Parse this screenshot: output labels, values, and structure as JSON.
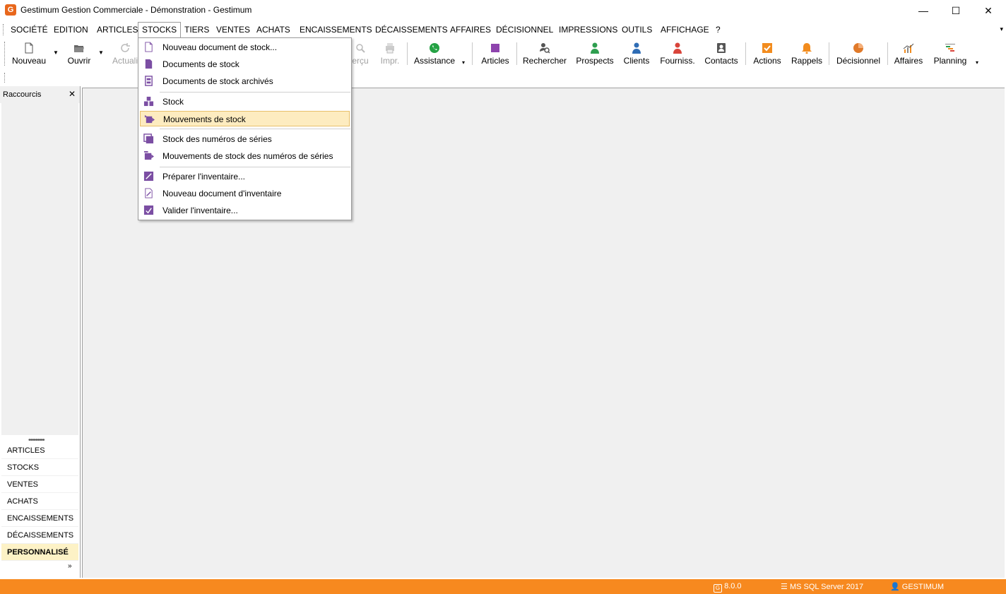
{
  "window": {
    "title": "Gestimum Gestion Commerciale - Démonstration - Gestimum",
    "app_icon": "G",
    "minimize_glyph": "—",
    "maximize_glyph": "☐",
    "close_glyph": "✕"
  },
  "menubar": {
    "items": [
      "SOCIÉTÉ",
      "EDITION",
      "ARTICLES",
      "STOCKS",
      "TIERS",
      "VENTES",
      "ACHATS",
      "ENCAISSEMENTS",
      "DÉCAISSEMENTS",
      "AFFAIRES",
      "DÉCISIONNEL",
      "IMPRESSIONS",
      "OUTILS",
      "AFFICHAGE",
      "?"
    ],
    "active": "STOCKS"
  },
  "toolbar": {
    "nouveau": "Nouveau",
    "ouvrir": "Ouvrir",
    "actualiser": "Actuali",
    "apercu": "erçu",
    "imprimer": "Impr.",
    "assistance": "Assistance",
    "articles": "Articles",
    "rechercher": "Rechercher",
    "prospects": "Prospects",
    "clients": "Clients",
    "fourniss": "Fourniss.",
    "contacts": "Contacts",
    "actions": "Actions",
    "rappels": "Rappels",
    "decisionnel": "Décisionnel",
    "affaires": "Affaires",
    "planning": "Planning"
  },
  "shortcuts_panel": {
    "title": "Raccourcis",
    "close": "✕",
    "splitter": "•••••••••",
    "items": [
      "ARTICLES",
      "STOCKS",
      "VENTES",
      "ACHATS",
      "ENCAISSEMENTS",
      "DÉCAISSEMENTS",
      "PERSONNALISÉ"
    ],
    "selected": "PERSONNALISÉ",
    "more": "»"
  },
  "stocks_menu": {
    "items": [
      {
        "label": "Nouveau document de stock...",
        "icon": "new-document-icon"
      },
      {
        "label": "Documents de stock",
        "icon": "document-icon"
      },
      {
        "label": "Documents de stock archivés",
        "icon": "archive-icon"
      },
      {
        "label": "Stock",
        "icon": "stock-boxes-icon"
      },
      {
        "label": "Mouvements de stock",
        "icon": "stock-movement-icon"
      },
      {
        "label": "Stock des numéros de séries",
        "icon": "serial-stock-icon"
      },
      {
        "label": "Mouvements de stock des numéros de séries",
        "icon": "serial-movement-icon"
      },
      {
        "label": "Préparer l'inventaire...",
        "icon": "prepare-inventory-icon"
      },
      {
        "label": "Nouveau document d'inventaire",
        "icon": "new-inventory-icon"
      },
      {
        "label": "Valider l'inventaire...",
        "icon": "validate-inventory-icon"
      }
    ],
    "highlighted": "Mouvements de stock"
  },
  "statusbar": {
    "version": "8.0.0",
    "database": "MS SQL Server 2017",
    "user": "GESTIMUM"
  },
  "colors": {
    "brand_orange": "#f7891f",
    "menu_purple": "#7b4ea3",
    "highlight": "#fdecc0"
  }
}
